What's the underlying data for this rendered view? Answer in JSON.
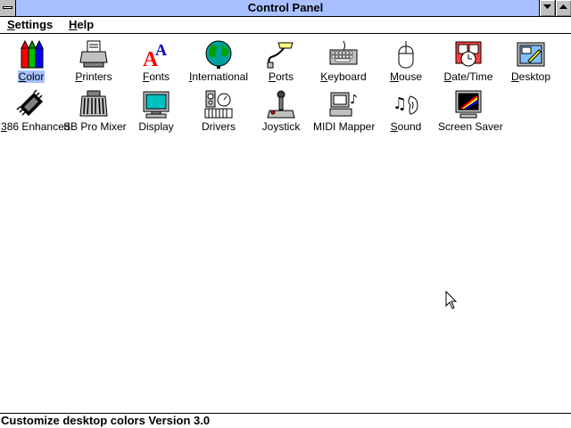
{
  "window": {
    "title": "Control Panel",
    "titlebar_color": "#a8c0ff"
  },
  "menu": [
    {
      "label": "Settings",
      "accel": "S",
      "rest": "ettings"
    },
    {
      "label": "Help",
      "accel": "H",
      "rest": "elp"
    }
  ],
  "icons": [
    {
      "label": "Color",
      "accel": "C",
      "rest": "olor",
      "icon": "color-pencils-icon",
      "selected": true
    },
    {
      "label": "Printers",
      "accel": "P",
      "rest": "rinters",
      "icon": "printer-icon"
    },
    {
      "label": "Fonts",
      "accel": "F",
      "rest": "onts",
      "icon": "fonts-icon"
    },
    {
      "label": "International",
      "accel": "I",
      "rest": "nternational",
      "icon": "globe-icon"
    },
    {
      "label": "Ports",
      "accel": "P",
      "rest": "orts",
      "icon": "port-cable-icon"
    },
    {
      "label": "Keyboard",
      "accel": "K",
      "rest": "eyboard",
      "icon": "keyboard-icon"
    },
    {
      "label": "Mouse",
      "accel": "M",
      "rest": "ouse",
      "icon": "mouse-icon"
    },
    {
      "label": "Date/Time",
      "accel": "D",
      "rest": "ate/Time",
      "icon": "calendar-clock-icon"
    },
    {
      "label": "Desktop",
      "accel": "D",
      "rest": "esktop",
      "icon": "desktop-icon"
    },
    {
      "label": "386 Enhanced",
      "accel": "3",
      "rest": "86 Enhanced",
      "icon": "chip-icon"
    },
    {
      "label": "SB Pro Mixer",
      "accel": "",
      "rest": "SB Pro Mixer",
      "icon": "mixer-icon"
    },
    {
      "label": "Display",
      "accel": "",
      "rest": "Display",
      "icon": "monitor-icon"
    },
    {
      "label": "Drivers",
      "accel": "",
      "rest": "Drivers",
      "icon": "drivers-icon"
    },
    {
      "label": "Joystick",
      "accel": "",
      "rest": "Joystick",
      "icon": "joystick-icon"
    },
    {
      "label": "MIDI Mapper",
      "accel": "",
      "rest": "MIDI Mapper",
      "icon": "midi-mapper-icon"
    },
    {
      "label": "Sound",
      "accel": "S",
      "rest": "ound",
      "icon": "sound-icon"
    },
    {
      "label": "Screen Saver",
      "accel": "",
      "rest": "Screen Saver",
      "icon": "screen-saver-icon"
    }
  ],
  "status": {
    "text": "Customize desktop colors Version 3.0"
  }
}
